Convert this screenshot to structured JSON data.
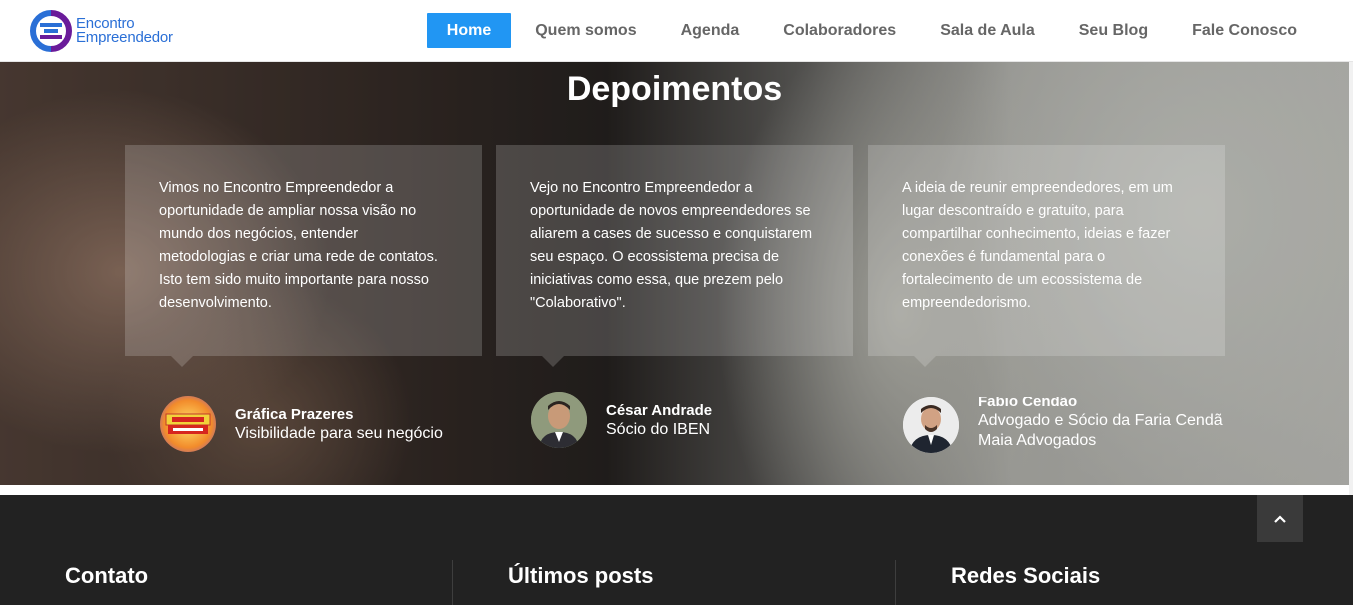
{
  "header": {
    "logo": {
      "line1": "Encontro",
      "line2": "Empreendedor"
    },
    "nav": [
      {
        "label": "Home",
        "active": true
      },
      {
        "label": "Quem somos"
      },
      {
        "label": "Agenda"
      },
      {
        "label": "Colaboradores"
      },
      {
        "label": "Sala de Aula"
      },
      {
        "label": "Seu Blog"
      },
      {
        "label": "Fale Conosco"
      }
    ]
  },
  "testimonials": {
    "title": "Depoimentos",
    "items": [
      {
        "text": "Vimos no Encontro Empreendedor a oportunidade de ampliar nossa visão no mundo dos negócios, entender metodologias e criar uma rede de contatos. Isto tem sido muito importante para nosso desenvolvimento.",
        "name": "Gráfica Prazeres",
        "role": "Visibilidade para seu negócio",
        "avatar_text": "GRÁFICA PRAZERES"
      },
      {
        "text": "Vejo no Encontro Empreendedor a oportunidade de novos empreendedores se aliarem a cases de sucesso e conquistarem seu espaço. O ecossistema precisa de iniciativas como essa, que prezem pelo \"Colaborativo\".",
        "name": "César Andrade",
        "role": "Sócio do IBEN"
      },
      {
        "text": "A ideia de reunir empreendedores, em um lugar descontraído e gratuito, para compartilhar conhecimento, ideias e fazer conexões é fundamental para o fortalecimento de um ecossistema de empreendedorismo.",
        "name": "Fabio Cendão",
        "role": "Advogado e Sócio da Faria Cendã Maia Advogados"
      }
    ]
  },
  "footer": {
    "columns": [
      {
        "title": "Contato"
      },
      {
        "title": "Últimos posts"
      },
      {
        "title": "Redes Sociais"
      }
    ]
  },
  "colors": {
    "accent": "#2196f3",
    "logo_blue": "#2a6fd6",
    "logo_purple": "#6a1b9a",
    "footer_bg": "#222222"
  }
}
